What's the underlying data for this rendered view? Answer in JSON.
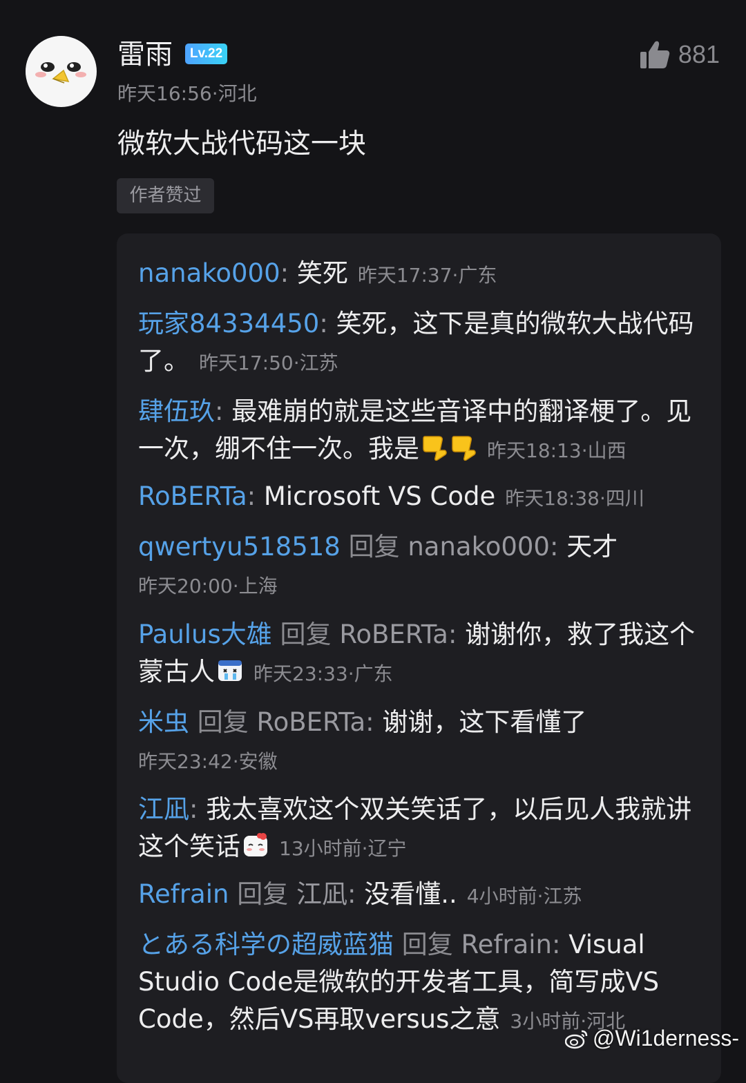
{
  "comment": {
    "username": "雷雨",
    "level": "Lv.22",
    "likes": "881",
    "meta": "昨天16:56·河北",
    "text": "微软大战代码这一块",
    "author_tag": "作者赞过"
  },
  "replies": [
    {
      "name": "nanako000",
      "reply_word": "",
      "target": "",
      "text": "笑死",
      "time": "昨天17:37·广东"
    },
    {
      "name": "玩家84334450",
      "reply_word": "",
      "target": "",
      "text": "笑死，这下是真的微软大战代码了。",
      "time": "昨天17:50·江苏"
    },
    {
      "name": "肆伍玖",
      "reply_word": "",
      "target": "",
      "text": "最难崩的就是这些音译中的翻译梗了。见一次，绷不住一次。我是",
      "time": "昨天18:13·山西"
    },
    {
      "name": "RoBERTa",
      "reply_word": "",
      "target": "",
      "text": "Microsoft VS Code",
      "time": "昨天18:38·四川"
    },
    {
      "name": "qwertyu518518",
      "reply_word": "回复",
      "target": "nanako000",
      "text": "天才",
      "time": "昨天20:00·上海"
    },
    {
      "name": "Paulus大雄",
      "reply_word": "回复",
      "target": "RoBERTa",
      "text": "谢谢你，救了我这个蒙古人",
      "time": "昨天23:33·广东"
    },
    {
      "name": "米虫",
      "reply_word": "回复",
      "target": "RoBERTa",
      "text": "谢谢，这下看懂了",
      "time": "昨天23:42·安徽"
    },
    {
      "name": "江凪",
      "reply_word": "",
      "target": "",
      "text": "我太喜欢这个双关笑话了，以后见人我就讲这个笑话",
      "time": "13小时前·辽宁"
    },
    {
      "name": "Refrain",
      "reply_word": "回复",
      "target": "江凪",
      "text": "没看懂..",
      "time": "4小时前·江苏"
    },
    {
      "name": "とある科学の超威蓝猫",
      "reply_word": "回复",
      "target": "Refrain",
      "text": "Visual Studio Code是微软的开发者工具，简写成VS Code，然后VS再取versus之意",
      "time": "3小时前·河北"
    }
  ],
  "watermark": "@Wi1derness-",
  "icons": {
    "like": "thumbs-up-icon",
    "weibo": "weibo-logo-icon",
    "thumbs_down": "thumbs-down-emoji",
    "crying": "crying-face-emoji",
    "blush": "blush-face-emoji"
  },
  "colors": {
    "background": "#141417",
    "reply_box": "#1e1e22",
    "username_blue": "#56a2e8",
    "meta_gray": "#8c8c91"
  }
}
